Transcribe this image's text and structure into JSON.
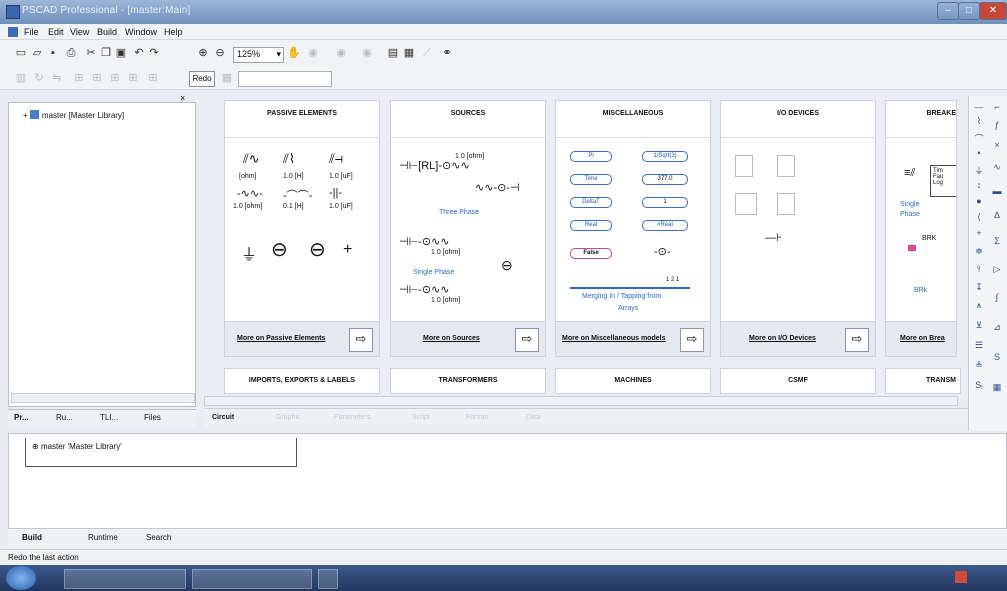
{
  "window": {
    "title": "PSCAD Professional - [master:Main]",
    "min": "–",
    "max": "□",
    "close": "✕"
  },
  "menu": [
    "File",
    "Edit",
    "View",
    "Build",
    "Window",
    "Help"
  ],
  "toolbar": {
    "zoom": "125%",
    "redo_label": "Redo",
    "zoom_arrow": "▾"
  },
  "left_panel": {
    "tree_root": "master [Master Library]",
    "expand": "+",
    "close": "×",
    "tabs": [
      "Pr...",
      "Ru...",
      "TLI...",
      "Files"
    ]
  },
  "cards": [
    {
      "title": "PASSIVE ELEMENTS",
      "more": "More on Passive Elements"
    },
    {
      "title": "SOURCES",
      "more": "More on Sources"
    },
    {
      "title": "MISCELLANEOUS",
      "more": "More on Miscellaneous models"
    },
    {
      "title": "I/O DEVICES",
      "more": "More on I/O Devices"
    },
    {
      "title": "BREAKE",
      "more": "More on Brea"
    }
  ],
  "cards_row2": [
    "IMPORTS, EXPORTS & LABELS",
    "TRANSFORMERS",
    "MACHINES",
    "CSMF",
    "TRANSM"
  ],
  "passive": {
    "r1": [
      "[ohm]",
      "1.0 [H]",
      "1.0 [uF]"
    ],
    "r2": [
      "1.0 [ohm]",
      "0.1 [H]",
      "1.0 [uF]"
    ]
  },
  "sources": {
    "rl": "RL",
    "v1": "1.0 [ohm]",
    "three": "Three Phase",
    "v2": "1.0 [ohm]",
    "single": "Single Phase",
    "v3": "1.0 [ohm]"
  },
  "misc": {
    "pills_left": [
      "Pi",
      "Time",
      "DeltaT",
      "Real",
      "False"
    ],
    "pills_right": [
      "1/Sqrt(3)",
      "377.0",
      "1",
      "#Real",
      ""
    ],
    "merge": "Merging In / Tapping from",
    "arrays": "Arrays"
  },
  "breaker": {
    "single": "Single",
    "phase": "Phase",
    "brk": "BRK",
    "brk2": "BRk",
    "tim": "Tim",
    "fau": "Fau",
    "log": "Log"
  },
  "circuit_tabs": [
    "Circuit",
    "Graphic",
    "Parameters",
    "Script",
    "Fortran",
    "Data"
  ],
  "build": {
    "tree": "master 'Master Library'",
    "tabs": [
      "Build",
      "Runtime",
      "Search"
    ]
  },
  "status": "Redo the last action",
  "colors": {
    "accent": "#2c6ac7",
    "titlebar": "#6f90bd",
    "taskbar": "#1f355e"
  }
}
